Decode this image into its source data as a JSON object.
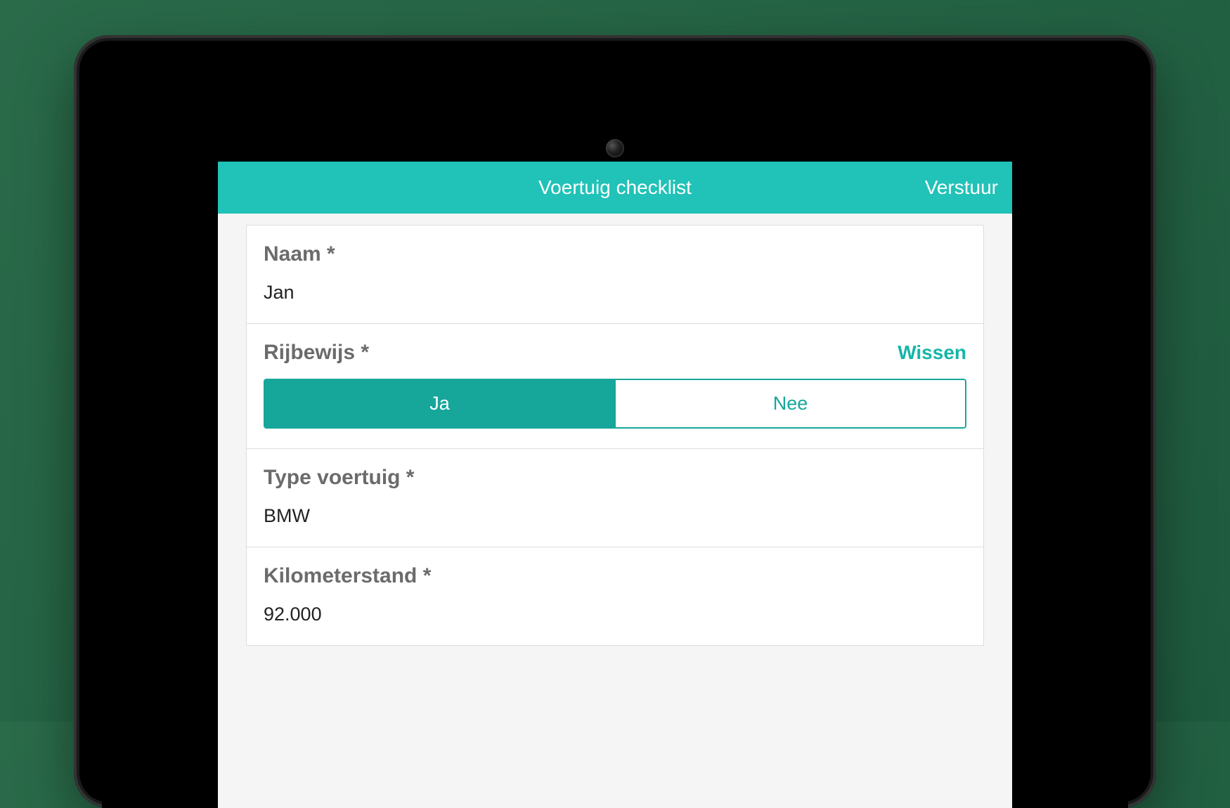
{
  "header": {
    "title": "Voertuig checklist",
    "send_label": "Verstuur"
  },
  "form": {
    "name": {
      "label": "Naam *",
      "value": "Jan"
    },
    "license": {
      "label": "Rijbewijs *",
      "clear_label": "Wissen",
      "option_yes": "Ja",
      "option_no": "Nee",
      "selected": "Ja"
    },
    "vehicle_type": {
      "label": "Type voertuig *",
      "value": "BMW"
    },
    "mileage": {
      "label": "Kilometerstand *",
      "value": "92.000"
    }
  },
  "colors": {
    "accent": "#21c2b7",
    "accent_dark": "#16a69a"
  }
}
